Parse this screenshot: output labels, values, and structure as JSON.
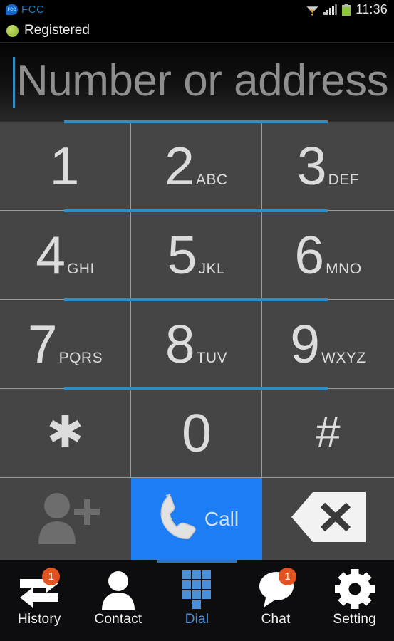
{
  "status_bar": {
    "app_badge_text": "FCC",
    "app_name": "FCC",
    "wifi_icon": "wifi-icon",
    "signal_icon": "signal-bars-icon",
    "battery_icon": "battery-icon",
    "clock": "11:36"
  },
  "registration": {
    "status_icon": "green-dot-icon",
    "label": "Registered"
  },
  "input": {
    "placeholder": "Number or address",
    "value": "",
    "caret_color": "#2f8fc4"
  },
  "keypad": {
    "rows": [
      [
        {
          "digit": "1",
          "letters": "",
          "name": "key-1"
        },
        {
          "digit": "2",
          "letters": "ABC",
          "name": "key-2"
        },
        {
          "digit": "3",
          "letters": "DEF",
          "name": "key-3"
        }
      ],
      [
        {
          "digit": "4",
          "letters": "GHI",
          "name": "key-4"
        },
        {
          "digit": "5",
          "letters": "JKL",
          "name": "key-5"
        },
        {
          "digit": "6",
          "letters": "MNO",
          "name": "key-6"
        }
      ],
      [
        {
          "digit": "7",
          "letters": "PQRS",
          "name": "key-7"
        },
        {
          "digit": "8",
          "letters": "TUV",
          "name": "key-8"
        },
        {
          "digit": "9",
          "letters": "WXYZ",
          "name": "key-9"
        }
      ]
    ],
    "symbol_row": [
      {
        "symbol": "✱",
        "name": "key-star"
      },
      {
        "symbol": "0",
        "name": "key-0"
      },
      {
        "symbol": "#",
        "name": "key-hash"
      }
    ]
  },
  "actions": {
    "add_contact_icon": "add-contact-icon",
    "call_label": "Call",
    "call_icon": "phone-handset-icon",
    "call_bg": "#1d7df5",
    "delete_icon": "backspace-delete-icon"
  },
  "nav": {
    "items": [
      {
        "label": "History",
        "icon": "two-arrows-icon",
        "badge": "1",
        "active": false
      },
      {
        "label": "Contact",
        "icon": "person-icon",
        "badge": "",
        "active": false
      },
      {
        "label": "Dial",
        "icon": "keypad-grid-icon",
        "badge": "",
        "active": true
      },
      {
        "label": "Chat",
        "icon": "speech-bubble-icon",
        "badge": "1",
        "active": false
      },
      {
        "label": "Setting",
        "icon": "gear-icon",
        "badge": "",
        "active": false
      }
    ],
    "badge_color": "#e2531f",
    "active_color": "#4b93db"
  }
}
